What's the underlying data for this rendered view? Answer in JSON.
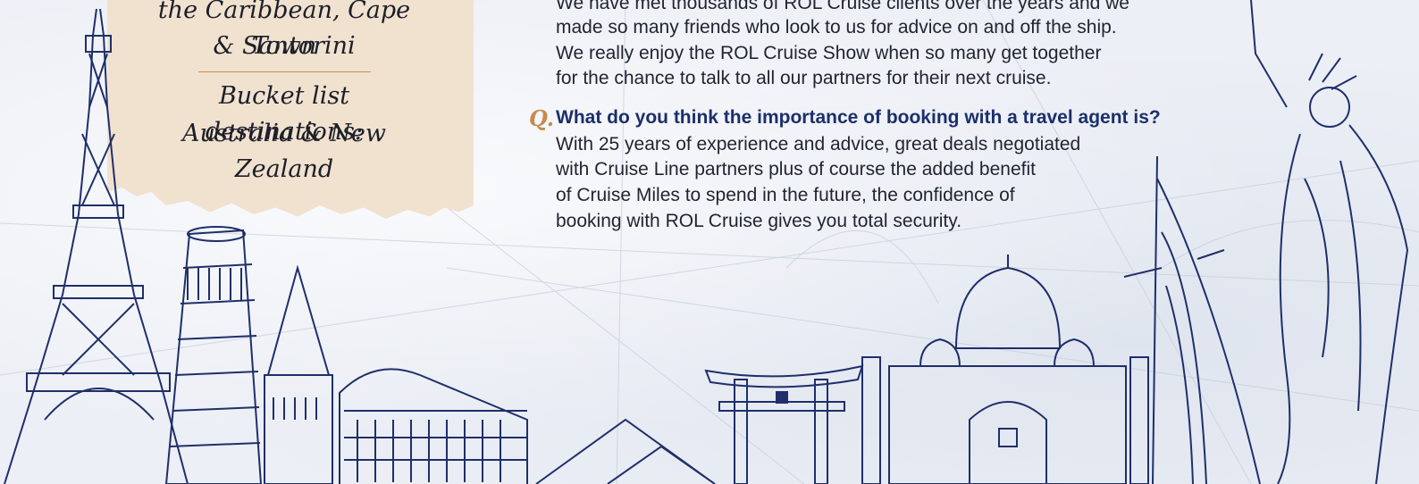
{
  "note": {
    "line1": "the Caribbean, Cape Town",
    "line2": "& Santorini",
    "line3": "Bucket list destinations:",
    "line4": "Australia & New Zealand"
  },
  "answer_prev": [
    "We have met thousands of ROL Cruise clients over the years and we",
    "made so many friends who look to us for advice on and off the ship.",
    "We really enjoy the ROL Cruise Show when so many get together",
    "for the chance to talk to all our partners for their next cruise."
  ],
  "q_marker": "Q.",
  "question": "What do you think the importance of booking with a travel agent is?",
  "answer": [
    "With 25 years of experience and advice, great deals negotiated",
    "with Cruise Line partners plus of course the added benefit",
    "of Cruise Miles to spend in the future, the confidence of",
    "booking with ROL Cruise gives you total security."
  ],
  "colors": {
    "ink": "#1f2f6a",
    "accent": "#c58b4f",
    "paper": "#f1e2cf"
  }
}
